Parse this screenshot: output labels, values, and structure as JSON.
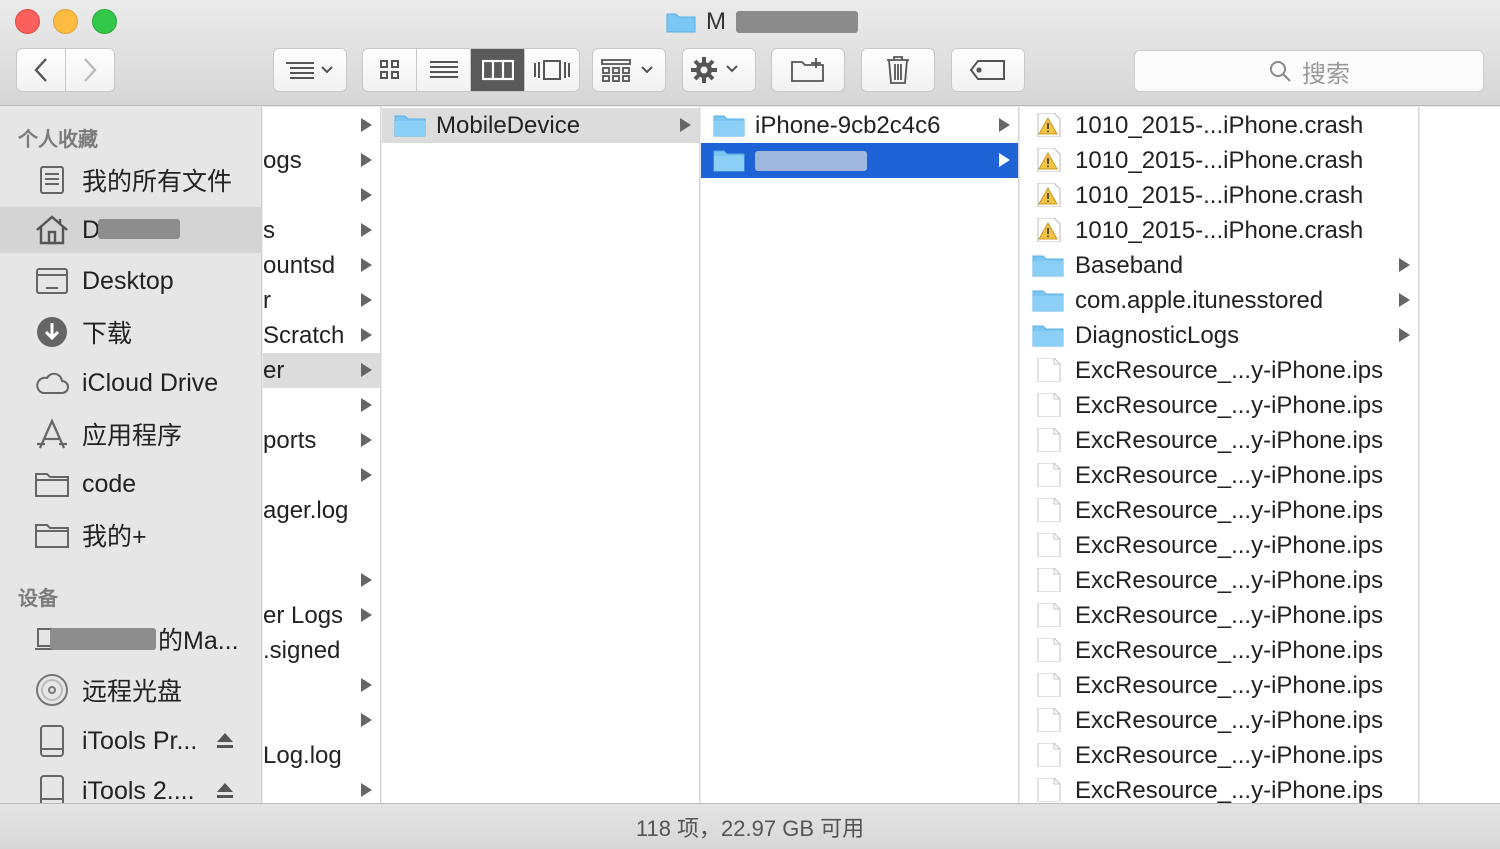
{
  "window": {
    "title_visible": "M",
    "colors": {
      "selection_blue": "#1d63d6",
      "folder_blue": "#7cc6f3"
    }
  },
  "toolbar": {
    "search_placeholder": "搜索",
    "icons": [
      "chevron-left-icon",
      "chevron-right-icon",
      "arrange-menu-icon",
      "icon-view-icon",
      "list-view-icon",
      "column-view-icon",
      "coverflow-view-icon",
      "group-menu-icon",
      "gear-menu-icon",
      "new-folder-icon",
      "trash-icon",
      "tag-icon"
    ]
  },
  "sidebar": {
    "favorites_header": "个人收藏",
    "favorites": [
      {
        "label": "我的所有文件",
        "icon": "all-files-icon"
      },
      {
        "label": "D",
        "icon": "home-icon",
        "redacted": true
      },
      {
        "label": "Desktop",
        "icon": "desktop-folder-icon"
      },
      {
        "label": "下载",
        "icon": "download-icon"
      },
      {
        "label": "iCloud Drive",
        "icon": "cloud-icon"
      },
      {
        "label": "应用程序",
        "icon": "applications-icon"
      },
      {
        "label": "code",
        "icon": "folder-icon"
      },
      {
        "label": "我的+",
        "icon": "folder-icon"
      }
    ],
    "devices_header": "设备",
    "devices": [
      {
        "label": "的Ma...",
        "icon": "laptop-icon",
        "redacted": true
      },
      {
        "label": "远程光盘",
        "icon": "disc-icon"
      },
      {
        "label": "iTools Pr...",
        "icon": "drive-icon",
        "eject": true
      },
      {
        "label": "iTools 2....",
        "icon": "drive-icon",
        "eject": true
      }
    ]
  },
  "columns": {
    "col1": [
      {
        "label": "",
        "arrow": true
      },
      {
        "label": "ogs",
        "arrow": true
      },
      {
        "label": "",
        "arrow": true
      },
      {
        "label": "s",
        "arrow": true
      },
      {
        "label": "ountsd",
        "arrow": true
      },
      {
        "label": "r",
        "arrow": true
      },
      {
        "label": "Scratch",
        "arrow": true
      },
      {
        "label": "er",
        "arrow": true,
        "selected": true
      },
      {
        "label": "",
        "arrow": true
      },
      {
        "label": "ports",
        "arrow": true
      },
      {
        "label": "",
        "arrow": true
      },
      {
        "label": "ager.log",
        "arrow": false
      },
      {
        "label": "",
        "arrow": false
      },
      {
        "label": "",
        "arrow": true
      },
      {
        "label": "er Logs",
        "arrow": true
      },
      {
        "label": ".signed",
        "arrow": false
      },
      {
        "label": "",
        "arrow": true
      },
      {
        "label": "",
        "arrow": true
      },
      {
        "label": "Log.log",
        "arrow": false
      },
      {
        "label": "",
        "arrow": true
      }
    ],
    "col2": [
      {
        "label": "MobileDevice",
        "type": "folder",
        "selected": true
      }
    ],
    "col3": [
      {
        "label": "iPhone-9cb2c4c6",
        "type": "folder"
      },
      {
        "label": "",
        "type": "folder",
        "selected_blue": true,
        "redacted": true
      }
    ],
    "col4": [
      {
        "label": "1010_2015-...iPhone.crash",
        "type": "crash"
      },
      {
        "label": "1010_2015-...iPhone.crash",
        "type": "crash"
      },
      {
        "label": "1010_2015-...iPhone.crash",
        "type": "crash"
      },
      {
        "label": "1010_2015-...iPhone.crash",
        "type": "crash"
      },
      {
        "label": "Baseband",
        "type": "folder"
      },
      {
        "label": "com.apple.itunesstored",
        "type": "folder"
      },
      {
        "label": "DiagnosticLogs",
        "type": "folder"
      },
      {
        "label": "ExcResource_...y-iPhone.ips",
        "type": "doc"
      },
      {
        "label": "ExcResource_...y-iPhone.ips",
        "type": "doc"
      },
      {
        "label": "ExcResource_...y-iPhone.ips",
        "type": "doc"
      },
      {
        "label": "ExcResource_...y-iPhone.ips",
        "type": "doc"
      },
      {
        "label": "ExcResource_...y-iPhone.ips",
        "type": "doc"
      },
      {
        "label": "ExcResource_...y-iPhone.ips",
        "type": "doc"
      },
      {
        "label": "ExcResource_...y-iPhone.ips",
        "type": "doc"
      },
      {
        "label": "ExcResource_...y-iPhone.ips",
        "type": "doc"
      },
      {
        "label": "ExcResource_...y-iPhone.ips",
        "type": "doc"
      },
      {
        "label": "ExcResource_...y-iPhone.ips",
        "type": "doc"
      },
      {
        "label": "ExcResource_...y-iPhone.ips",
        "type": "doc"
      },
      {
        "label": "ExcResource_...y-iPhone.ips",
        "type": "doc"
      },
      {
        "label": "ExcResource_...y-iPhone.ips",
        "type": "doc"
      }
    ]
  },
  "status": {
    "text": "118 项，22.97 GB 可用"
  }
}
